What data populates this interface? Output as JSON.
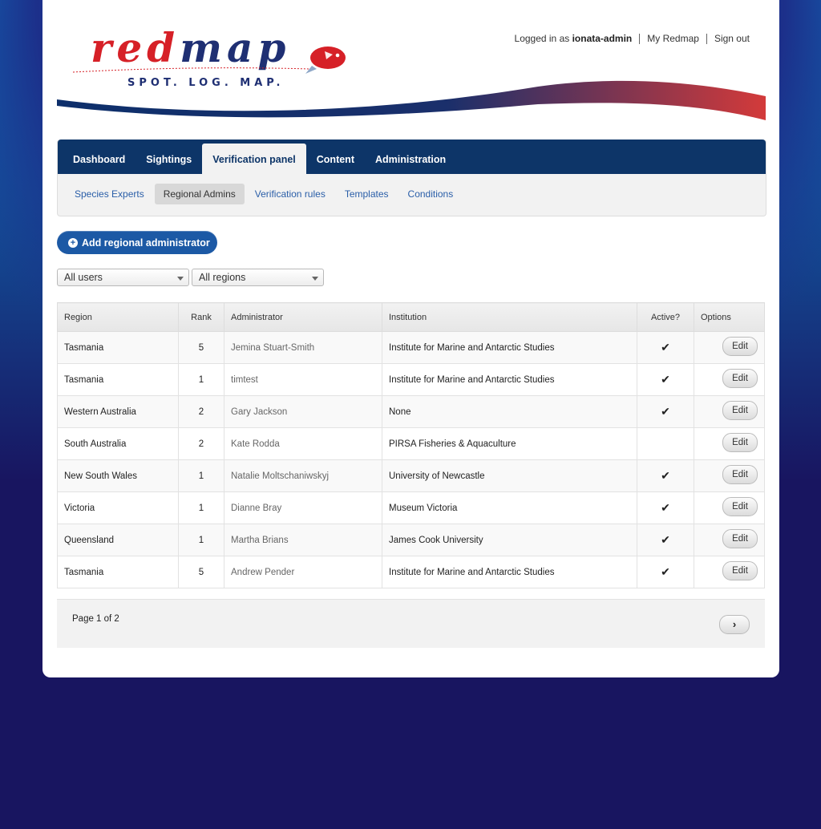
{
  "brand": {
    "logo_text": "redmap",
    "tagline": "SPOT. LOG. MAP."
  },
  "header": {
    "logged_in_prefix": "Logged in as",
    "username": "ionata-admin",
    "my_redmap": "My Redmap",
    "sign_out": "Sign out"
  },
  "nav": {
    "tabs": [
      "Dashboard",
      "Sightings",
      "Verification panel",
      "Content",
      "Administration"
    ],
    "active_tab": "Verification panel",
    "subtabs": [
      "Species Experts",
      "Regional Admins",
      "Verification rules",
      "Templates",
      "Conditions"
    ],
    "active_subtab": "Regional Admins"
  },
  "actions": {
    "add_label": "Add regional administrator"
  },
  "filters": {
    "users": "All users",
    "regions": "All regions"
  },
  "table": {
    "headers": [
      "Region",
      "Rank",
      "Administrator",
      "Institution",
      "Active?",
      "Options"
    ],
    "edit_label": "Edit",
    "rows": [
      {
        "region": "Tasmania",
        "rank": "5",
        "admin": "Jemina Stuart-Smith",
        "institution": "Institute for Marine and Antarctic Studies",
        "active": true
      },
      {
        "region": "Tasmania",
        "rank": "1",
        "admin": "timtest",
        "institution": "Institute for Marine and Antarctic Studies",
        "active": true
      },
      {
        "region": "Western Australia",
        "rank": "2",
        "admin": "Gary Jackson",
        "institution": "None",
        "active": true
      },
      {
        "region": "South Australia",
        "rank": "2",
        "admin": "Kate Rodda",
        "institution": "PIRSA Fisheries & Aquaculture",
        "active": false
      },
      {
        "region": "New South Wales",
        "rank": "1",
        "admin": "Natalie Moltschaniwskyj",
        "institution": "University of Newcastle",
        "active": true
      },
      {
        "region": "Victoria",
        "rank": "1",
        "admin": "Dianne Bray",
        "institution": "Museum Victoria",
        "active": true
      },
      {
        "region": "Queensland",
        "rank": "1",
        "admin": "Martha Brians",
        "institution": "James Cook University",
        "active": true
      },
      {
        "region": "Tasmania",
        "rank": "5",
        "admin": "Andrew Pender",
        "institution": "Institute for Marine and Antarctic Studies",
        "active": true
      }
    ]
  },
  "pager": {
    "text": "Page 1 of 2"
  },
  "colors": {
    "nav": "#0d3568",
    "accent": "#1c59a5",
    "brand_red": "#d62027"
  }
}
